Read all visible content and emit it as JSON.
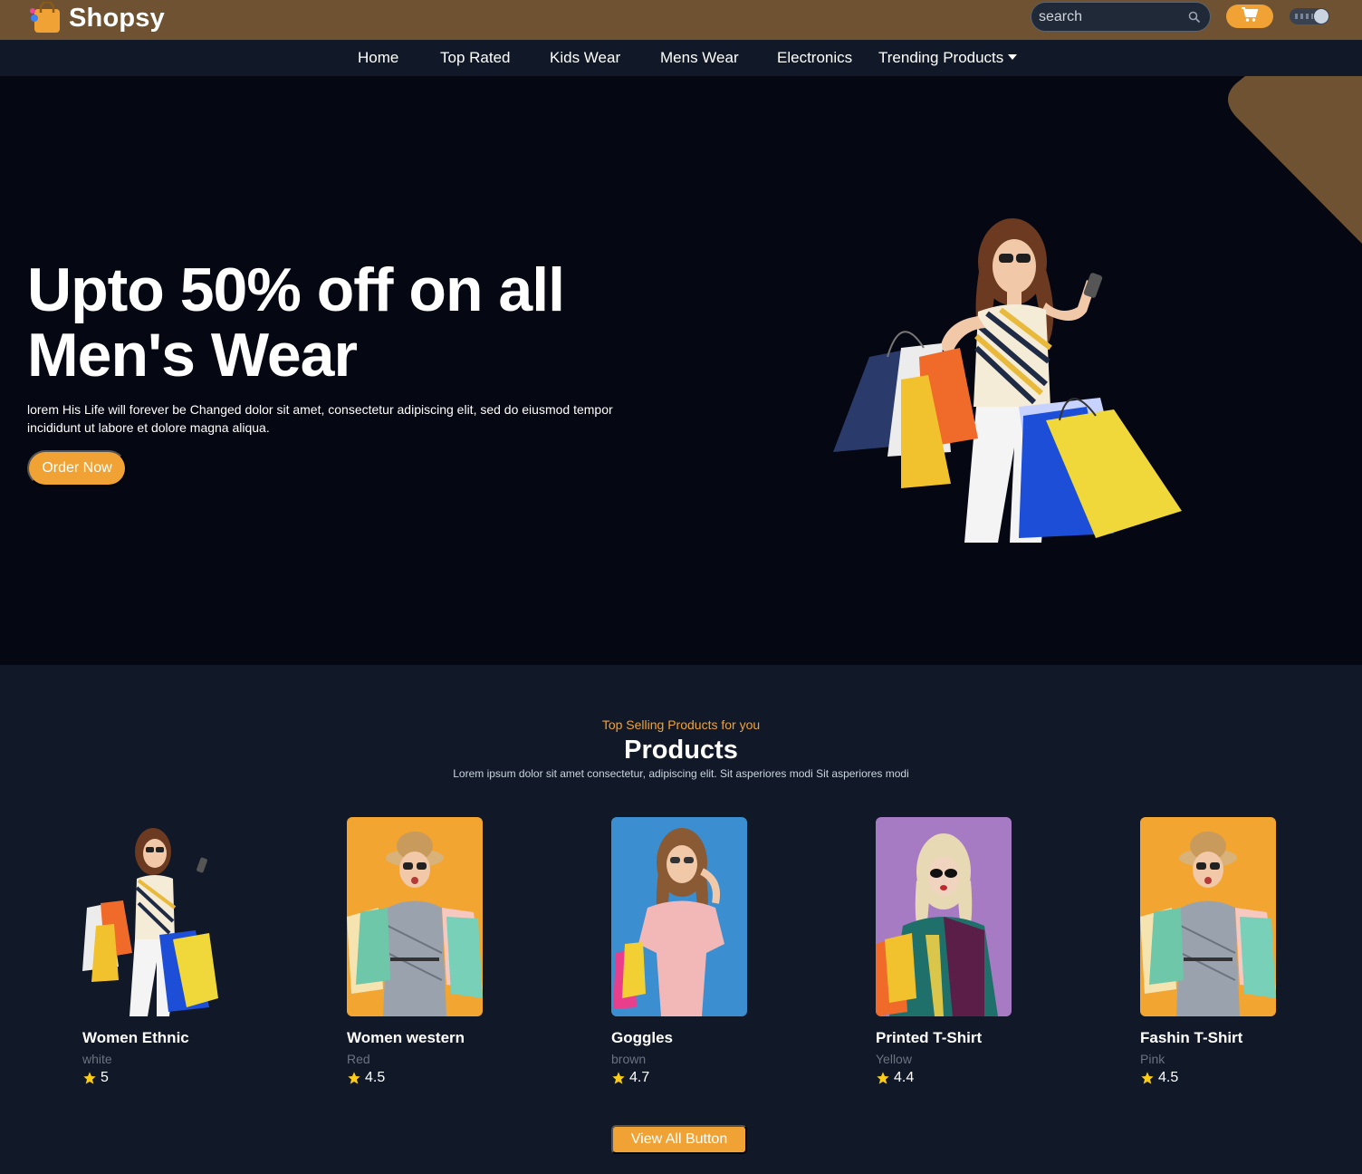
{
  "brand": {
    "name": "Shopsy",
    "accent": "#f0a334",
    "topbar_color": "#6e5232"
  },
  "search": {
    "placeholder": "search"
  },
  "icons": {
    "search": "search-icon",
    "cart": "cart-icon",
    "theme": "theme-toggle",
    "logo": "shopping-bag-logo-icon",
    "star": "star-icon"
  },
  "nav": {
    "items": [
      {
        "label": "Home"
      },
      {
        "label": "Top Rated"
      },
      {
        "label": "Kids Wear"
      },
      {
        "label": "Mens Wear"
      },
      {
        "label": "Electronics"
      },
      {
        "label": "Trending Products"
      }
    ]
  },
  "hero": {
    "title": "Upto 50% off on all Men's Wear",
    "description": "lorem His Life will forever be Changed dolor sit amet, consectetur adipiscing elit, sed do eiusmod tempor incididunt ut labore et dolore magna aliqua.",
    "cta": "Order Now"
  },
  "products": {
    "subtitle": "Top Selling Products for you",
    "title": "Products",
    "description": "Lorem ipsum dolor sit amet consectetur, adipiscing elit. Sit asperiores modi Sit asperiores modi",
    "items": [
      {
        "name": "Women Ethnic",
        "color": "white",
        "rating": "5",
        "bg": "#111827"
      },
      {
        "name": "Women western",
        "color": "Red",
        "rating": "4.5",
        "bg": "#f2a531"
      },
      {
        "name": "Goggles",
        "color": "brown",
        "rating": "4.7",
        "bg": "#3b8fd0"
      },
      {
        "name": "Printed T-Shirt",
        "color": "Yellow",
        "rating": "4.4",
        "bg": "#a77ac4"
      },
      {
        "name": "Fashin T-Shirt",
        "color": "Pink",
        "rating": "4.5",
        "bg": "#f2a531"
      }
    ],
    "view_all": "View All Button"
  }
}
